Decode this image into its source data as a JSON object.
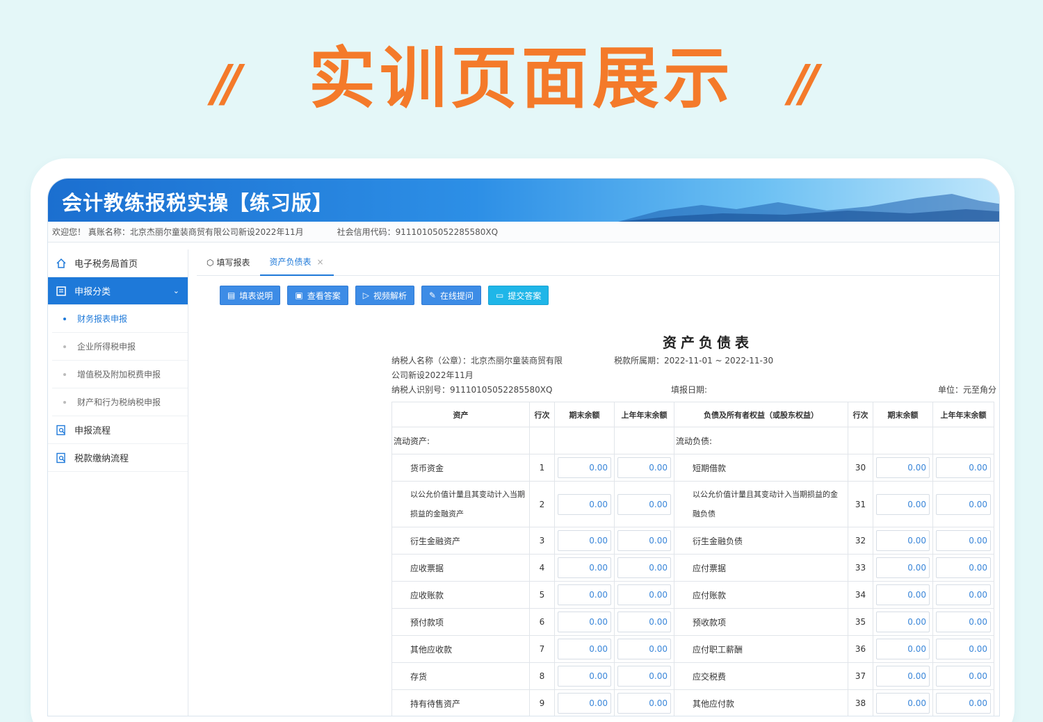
{
  "promo": {
    "title": "实训页面展示",
    "slash": "//"
  },
  "app": {
    "title": "会计教练报税实操【练习版】",
    "info_left": "欢迎您！ 真账名称：北京杰丽尔童装商贸有限公司新设2022年11月",
    "info_right": "社会信用代码：91110105052285580XQ"
  },
  "sidebar": {
    "items": [
      {
        "label": "电子税务局首页"
      },
      {
        "label": "申报分类"
      },
      {
        "label": "申报流程"
      },
      {
        "label": "税款缴纳流程"
      }
    ],
    "sub": [
      "财务报表申报",
      "企业所得税申报",
      "增值税及附加税费申报",
      "财产和行为税纳税申报"
    ]
  },
  "tabs": [
    "填写报表",
    "资产负债表"
  ],
  "toolbar": [
    "填表说明",
    "查看答案",
    "视频解析",
    "在线提问",
    "提交答案"
  ],
  "report": {
    "title": "资产负债表",
    "taxpayer_name": "纳税人名称（公章）：北京杰丽尔童装商贸有限",
    "taxpayer_name2": "公司新设2022年11月",
    "period": "税款所属期：2022-11-01 ~ 2022-11-30",
    "taxpayer_id": "纳税人识别号：91110105052285580XQ",
    "fill_date": "填报日期:",
    "unit": "单位：元至角分",
    "headers": [
      "资产",
      "行次",
      "期末余额",
      "上年年末余额",
      "负债及所有者权益（或股东权益）",
      "行次",
      "期末余额",
      "上年年末余额"
    ],
    "left_cat": "流动资产:",
    "right_cat": "流动负债:",
    "rows": [
      {
        "a": "货币资金",
        "an": "1",
        "l": "短期借款",
        "ln": "30",
        "a1": "0.00",
        "a2": "0.00",
        "l1": "0.00",
        "l2": "0.00"
      },
      {
        "a": "以公允价值计量且其变动计入当期损益的金融资产",
        "an": "2",
        "l": "以公允价值计量且其变动计入当期损益的金融负债",
        "ln": "31",
        "a1": "0.00",
        "a2": "0.00",
        "l1": "0.00",
        "l2": "0.00"
      },
      {
        "a": "衍生金融资产",
        "an": "3",
        "l": "衍生金融负债",
        "ln": "32",
        "a1": "0.00",
        "a2": "0.00",
        "l1": "0.00",
        "l2": "0.00"
      },
      {
        "a": "应收票据",
        "an": "4",
        "l": "应付票据",
        "ln": "33",
        "a1": "0.00",
        "a2": "0.00",
        "l1": "0.00",
        "l2": "0.00"
      },
      {
        "a": "应收账款",
        "an": "5",
        "l": "应付账款",
        "ln": "34",
        "a1": "0.00",
        "a2": "0.00",
        "l1": "0.00",
        "l2": "0.00"
      },
      {
        "a": "预付款项",
        "an": "6",
        "l": "预收款项",
        "ln": "35",
        "a1": "0.00",
        "a2": "0.00",
        "l1": "0.00",
        "l2": "0.00"
      },
      {
        "a": "其他应收款",
        "an": "7",
        "l": "应付职工薪酬",
        "ln": "36",
        "a1": "0.00",
        "a2": "0.00",
        "l1": "0.00",
        "l2": "0.00"
      },
      {
        "a": "存货",
        "an": "8",
        "l": "应交税费",
        "ln": "37",
        "a1": "0.00",
        "a2": "0.00",
        "l1": "0.00",
        "l2": "0.00"
      },
      {
        "a": "持有待售资产",
        "an": "9",
        "l": "其他应付款",
        "ln": "38",
        "a1": "0.00",
        "a2": "0.00",
        "l1": "0.00",
        "l2": "0.00"
      }
    ]
  },
  "colors": {
    "accent": "#f47a2a",
    "primary": "#1e79d9",
    "value": "#3a86d9"
  }
}
